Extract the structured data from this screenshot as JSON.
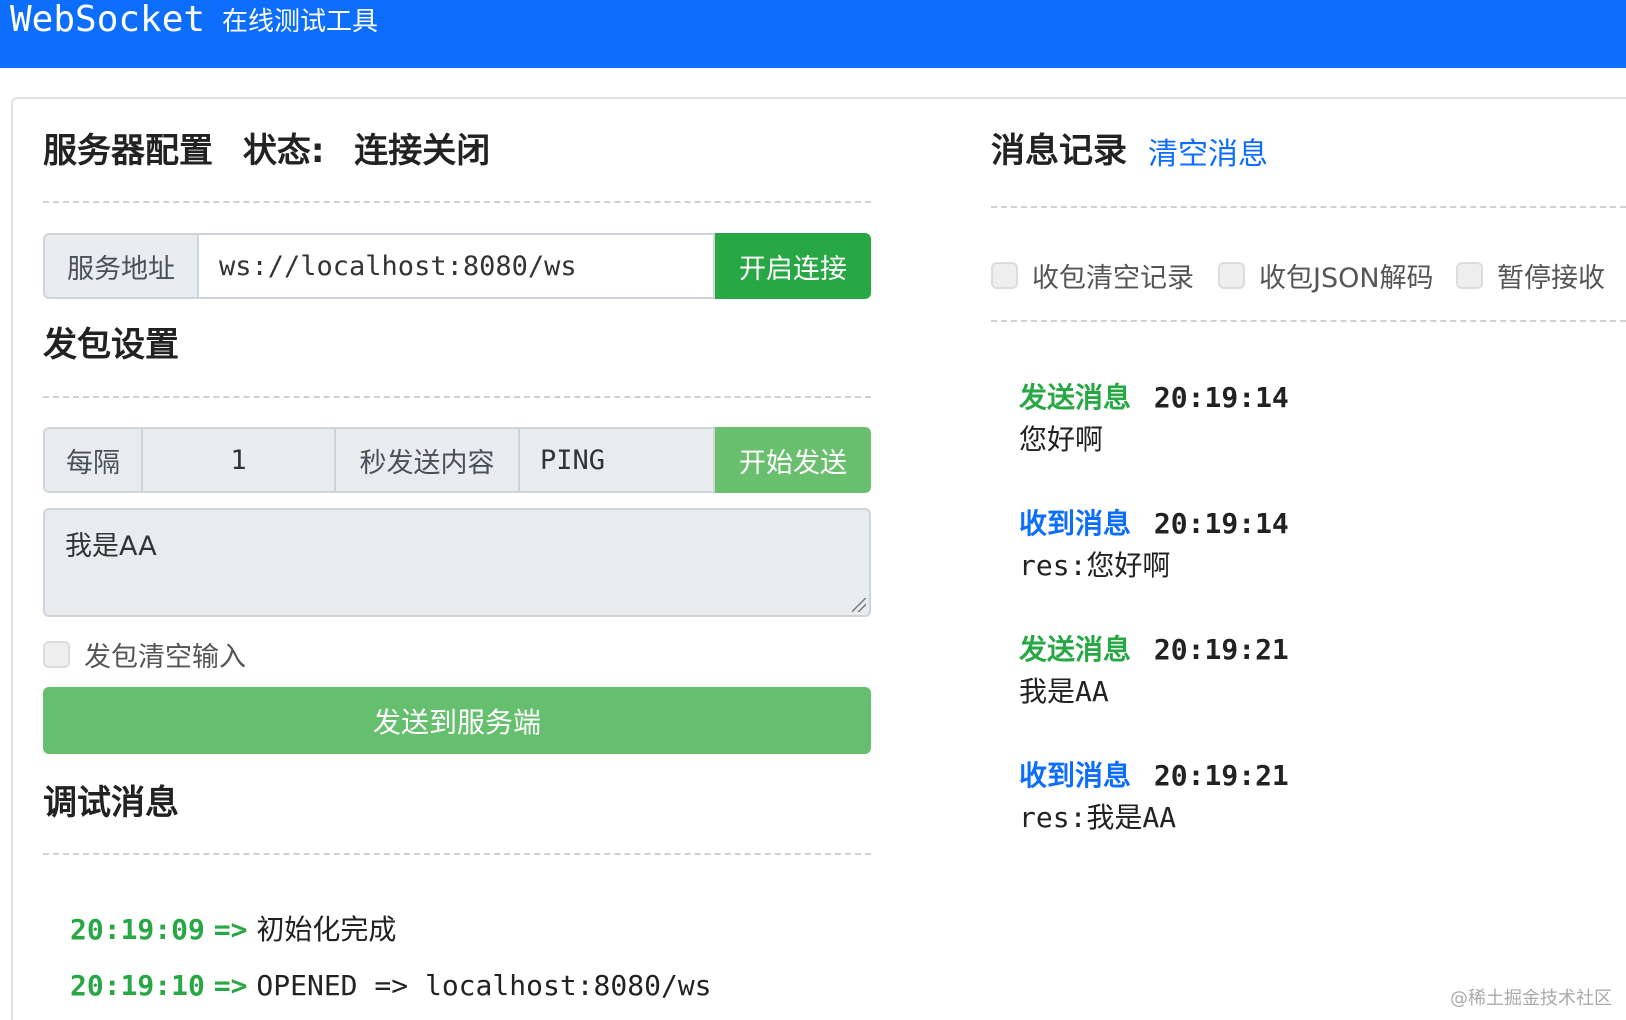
{
  "header": {
    "brand": "WebSocket",
    "subtitle": "在线测试工具"
  },
  "server": {
    "title": "服务器配置",
    "status_label": "状态:",
    "status_value": "连接关闭",
    "address_label": "服务地址",
    "address_value": "ws://localhost:8080/ws",
    "connect_button": "开启连接"
  },
  "send_settings": {
    "title": "发包设置",
    "every_label": "每隔",
    "interval_value": "1",
    "content_label": "秒发送内容",
    "content_value": "PING",
    "start_button": "开始发送",
    "message_value": "我是AA",
    "clear_input_label": "发包清空输入",
    "send_button": "发送到服务端"
  },
  "debug": {
    "title": "调试消息",
    "lines": [
      {
        "time": "20:19:09",
        "arrow": "=>",
        "text": "初始化完成"
      },
      {
        "time": "20:19:10",
        "arrow": "=>",
        "text": "OPENED => localhost:8080/ws"
      }
    ]
  },
  "messages": {
    "title": "消息记录",
    "clear_link": "清空消息",
    "options": [
      "收包清空记录",
      "收包JSON解码",
      "暂停接收"
    ],
    "items": [
      {
        "label": "发送消息",
        "time": "20:19:14",
        "body": "您好啊"
      },
      {
        "label": "收到消息",
        "time": "20:19:14",
        "body": "res:您好啊"
      },
      {
        "label": "发送消息",
        "time": "20:19:21",
        "body": "我是AA"
      },
      {
        "label": "收到消息",
        "time": "20:19:21",
        "body": "res:我是AA"
      }
    ]
  },
  "watermark": "@稀土掘金技术社区"
}
